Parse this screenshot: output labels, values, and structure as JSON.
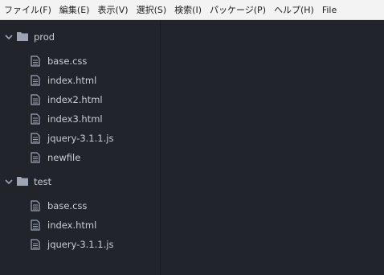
{
  "menubar": {
    "items": [
      "ファイル(F)",
      "編集(E)",
      "表示(V)",
      "選択(S)",
      "検索(I)",
      "パッケージ(P)",
      "ヘルプ(H)",
      "File"
    ]
  },
  "tree": {
    "folders": [
      {
        "name": "prod",
        "expanded": true,
        "files": [
          "base.css",
          "index.html",
          "index2.html",
          "index3.html",
          "jquery-3.1.1.js",
          "newfile"
        ]
      },
      {
        "name": "test",
        "expanded": true,
        "files": [
          "base.css",
          "index.html",
          "jquery-3.1.1.js"
        ]
      }
    ]
  },
  "colors": {
    "background": "#21252b",
    "text": "#c8ccd4",
    "icon": "#9da5b4",
    "menubar": "#f3f3f3"
  }
}
